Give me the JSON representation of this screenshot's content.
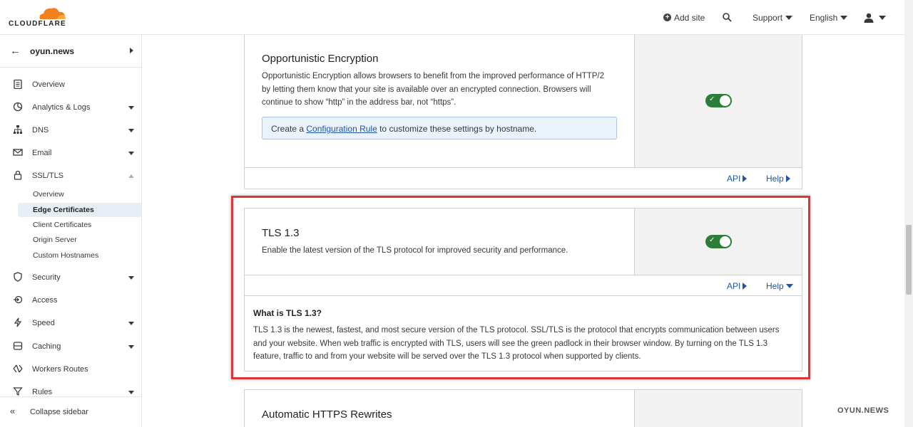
{
  "header": {
    "logo_text": "CLOUDFLARE",
    "add_site": "Add site",
    "support": "Support",
    "language": "English"
  },
  "sidebar": {
    "site_name": "oyun.news",
    "items": [
      {
        "label": "Overview",
        "icon": "clipboard-icon"
      },
      {
        "label": "Analytics & Logs",
        "icon": "chart-pie-icon"
      },
      {
        "label": "DNS",
        "icon": "network-icon"
      },
      {
        "label": "Email",
        "icon": "envelope-icon"
      },
      {
        "label": "SSL/TLS",
        "icon": "lock-icon"
      },
      {
        "label": "Security",
        "icon": "shield-icon"
      },
      {
        "label": "Access",
        "icon": "access-icon"
      },
      {
        "label": "Speed",
        "icon": "bolt-icon"
      },
      {
        "label": "Caching",
        "icon": "database-icon"
      },
      {
        "label": "Workers Routes",
        "icon": "workers-icon"
      },
      {
        "label": "Rules",
        "icon": "funnel-icon"
      }
    ],
    "ssl_sub": [
      "Overview",
      "Edge Certificates",
      "Client Certificates",
      "Origin Server",
      "Custom Hostnames"
    ],
    "collapse": "Collapse sidebar"
  },
  "cards": {
    "oe": {
      "title": "Opportunistic Encryption",
      "desc": "Opportunistic Encryption allows browsers to benefit from the improved performance of HTTP/2 by letting them know that your site is available over an encrypted connection. Browsers will continue to show “http” in the address bar, not “https”.",
      "info_prefix": "Create a ",
      "info_link": "Configuration Rule",
      "info_suffix": " to customize these settings by hostname.",
      "enabled": true
    },
    "tls": {
      "title": "TLS 1.3",
      "desc": "Enable the latest version of the TLS protocol for improved security and performance.",
      "what_title": "What is TLS 1.3?",
      "what_text": "TLS 1.3 is the newest, fastest, and most secure version of the TLS protocol. SSL/TLS is the protocol that encrypts communication between users and your website. When web traffic is encrypted with TLS, users will see the green padlock in their browser window. By turning on the TLS 1.3 feature, traffic to and from your website will be served over the TLS 1.3 protocol when supported by clients.",
      "enabled": true
    },
    "https": {
      "title": "Automatic HTTPS Rewrites"
    }
  },
  "links": {
    "api": "API",
    "help": "Help"
  },
  "colors": {
    "accent": "#1f56a8",
    "toggle_on": "#2c7d39",
    "highlight": "#d9363e",
    "logo_orange": "#f38020"
  },
  "watermark": "OYUN.NEWS"
}
